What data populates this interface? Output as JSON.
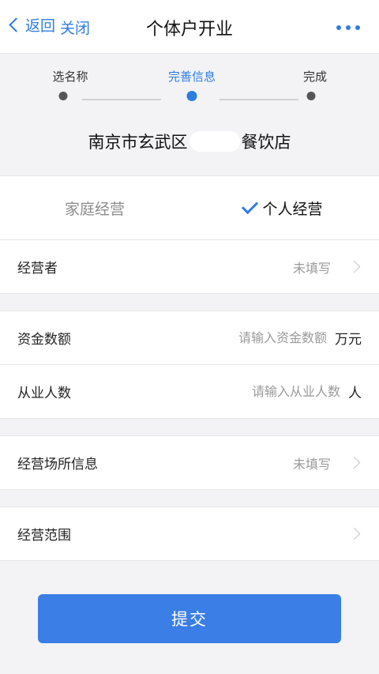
{
  "nav": {
    "back_label": "返回",
    "close_label": "关闭",
    "title": "个体户开业"
  },
  "steps": {
    "items": [
      "选名称",
      "完善信息",
      "完成"
    ],
    "current": 1,
    "accent": "#2f7de1"
  },
  "shop": {
    "name_prefix": "南京市玄武区",
    "name_suffix": "餐饮店"
  },
  "biz_type": {
    "options": [
      "家庭经营",
      "个人经营"
    ],
    "selected": "个人经营"
  },
  "form": {
    "operator": {
      "label": "经营者",
      "value": "未填写"
    },
    "capital": {
      "label": "资金数额",
      "placeholder": "请输入资金数额",
      "unit": "万元"
    },
    "staff": {
      "label": "从业人数",
      "placeholder": "请输入从业人数",
      "unit": "人"
    },
    "premises": {
      "label": "经营场所信息",
      "value": "未填写"
    },
    "scope": {
      "label": "经营范围"
    }
  },
  "submit_label": "提交"
}
